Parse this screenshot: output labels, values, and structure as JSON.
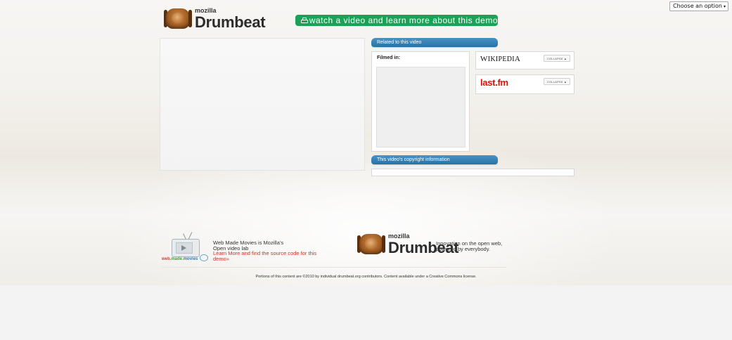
{
  "language_select": {
    "value": "Choose an option",
    "arrow": "▾"
  },
  "header": {
    "logo_mozilla": "mozilla",
    "logo_drumbeat": "Drumbeat",
    "watch_button_label": "watch a video and learn more about this demo",
    "watch_button_icon": "video-camera-icon",
    "accent_color": "#1aa356"
  },
  "related": {
    "tab_label": "Related to this video",
    "filmed_in_label": "Filmed in:",
    "tab_color": "#2573a8"
  },
  "side_boxes": {
    "wikipedia_logo": "Wikipedia",
    "wikipedia_collapse": "COLLAPSE ▲",
    "lastfm_logo": "last.fm",
    "lastfm_collapse": "COLLAPSE ▲",
    "lastfm_color": "#d51007"
  },
  "copyright": {
    "tab_label": "This video's copyright information"
  },
  "footer": {
    "wmm_logo_parts": [
      "web.",
      "made.",
      "movies"
    ],
    "wmm_line1": "Web Made Movies is Mozilla's",
    "wmm_line2": "Open video lab",
    "wmm_link": "Learn More and find the source code for this demo»",
    "drumbeat_mozilla": "mozilla",
    "drumbeat_name": "Drumbeat",
    "drumbeat_tagline_line1": "Innovation on the open web,",
    "drumbeat_tagline_line2": "powered by everybody.",
    "note": "Portions of this content are ©2010 by individual drumbeat.org contributors. Content available under a Creative Commons license."
  }
}
